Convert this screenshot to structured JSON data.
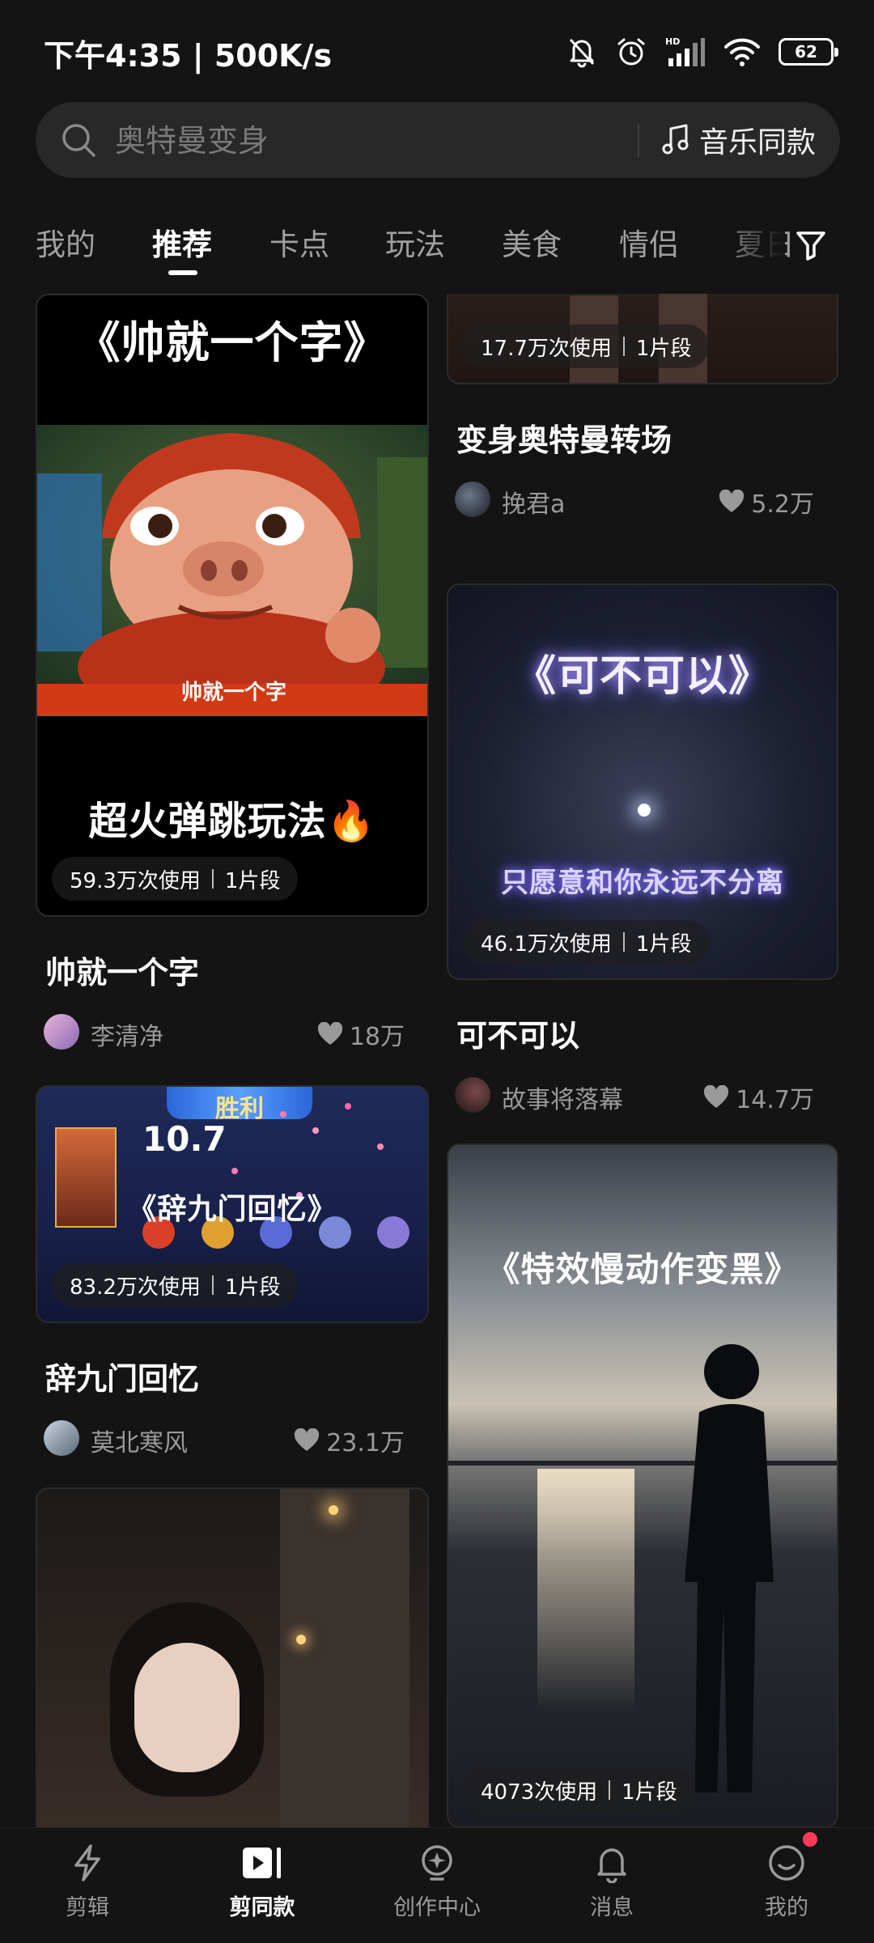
{
  "status_bar": {
    "time": "下午4:35 | 500K/s",
    "battery": "62"
  },
  "search": {
    "placeholder": "奥特曼变身",
    "music_label": "音乐同款"
  },
  "tabs": [
    {
      "label": "我的",
      "active": false
    },
    {
      "label": "推荐",
      "active": true
    },
    {
      "label": "卡点",
      "active": false
    },
    {
      "label": "玩法",
      "active": false
    },
    {
      "label": "美食",
      "active": false
    },
    {
      "label": "情侣",
      "active": false
    },
    {
      "label": "夏日",
      "active": false
    }
  ],
  "cards": [
    {
      "overlay_top": "《帅就一个字》",
      "subtitle": "帅就一个字",
      "overlay_bottom": "超火弹跳玩法🔥",
      "usage": "59.3万次使用",
      "segments": "1片段",
      "title": "帅就一个字",
      "author": "李清净",
      "likes": "18万"
    },
    {
      "usage": "17.7万次使用",
      "segments": "1片段",
      "title": "变身奥特曼转场",
      "author": "挽君a",
      "likes": "5.2万"
    },
    {
      "overlay_top": "《可不可以》",
      "overlay_glow": "只愿意和你永远不分离",
      "usage": "46.1万次使用",
      "segments": "1片段",
      "title": "可不可以",
      "author": "故事将落幕",
      "likes": "14.7万"
    },
    {
      "overlay_top": "《辞九门回忆》",
      "game_score": "10.7",
      "game_banner": "胜利",
      "usage": "83.2万次使用",
      "segments": "1片段",
      "title": "辞九门回忆",
      "author": "莫北寒风",
      "likes": "23.1万"
    },
    {
      "overlay_top": "《特效慢动作变黑》",
      "usage": "4073次使用",
      "segments": "1片段"
    },
    {
      "description": "night street portrait"
    }
  ],
  "bottom_nav": [
    {
      "label": "剪辑",
      "icon": "lightning-icon",
      "active": false
    },
    {
      "label": "剪同款",
      "icon": "play-template-icon",
      "active": true
    },
    {
      "label": "创作中心",
      "icon": "lightbulb-icon",
      "active": false
    },
    {
      "label": "消息",
      "icon": "bell-icon",
      "active": false
    },
    {
      "label": "我的",
      "icon": "smile-icon",
      "active": false
    }
  ],
  "colors": {
    "background": "#141414",
    "search_bg": "#282828",
    "notification_dot": "#ff3b5c"
  }
}
